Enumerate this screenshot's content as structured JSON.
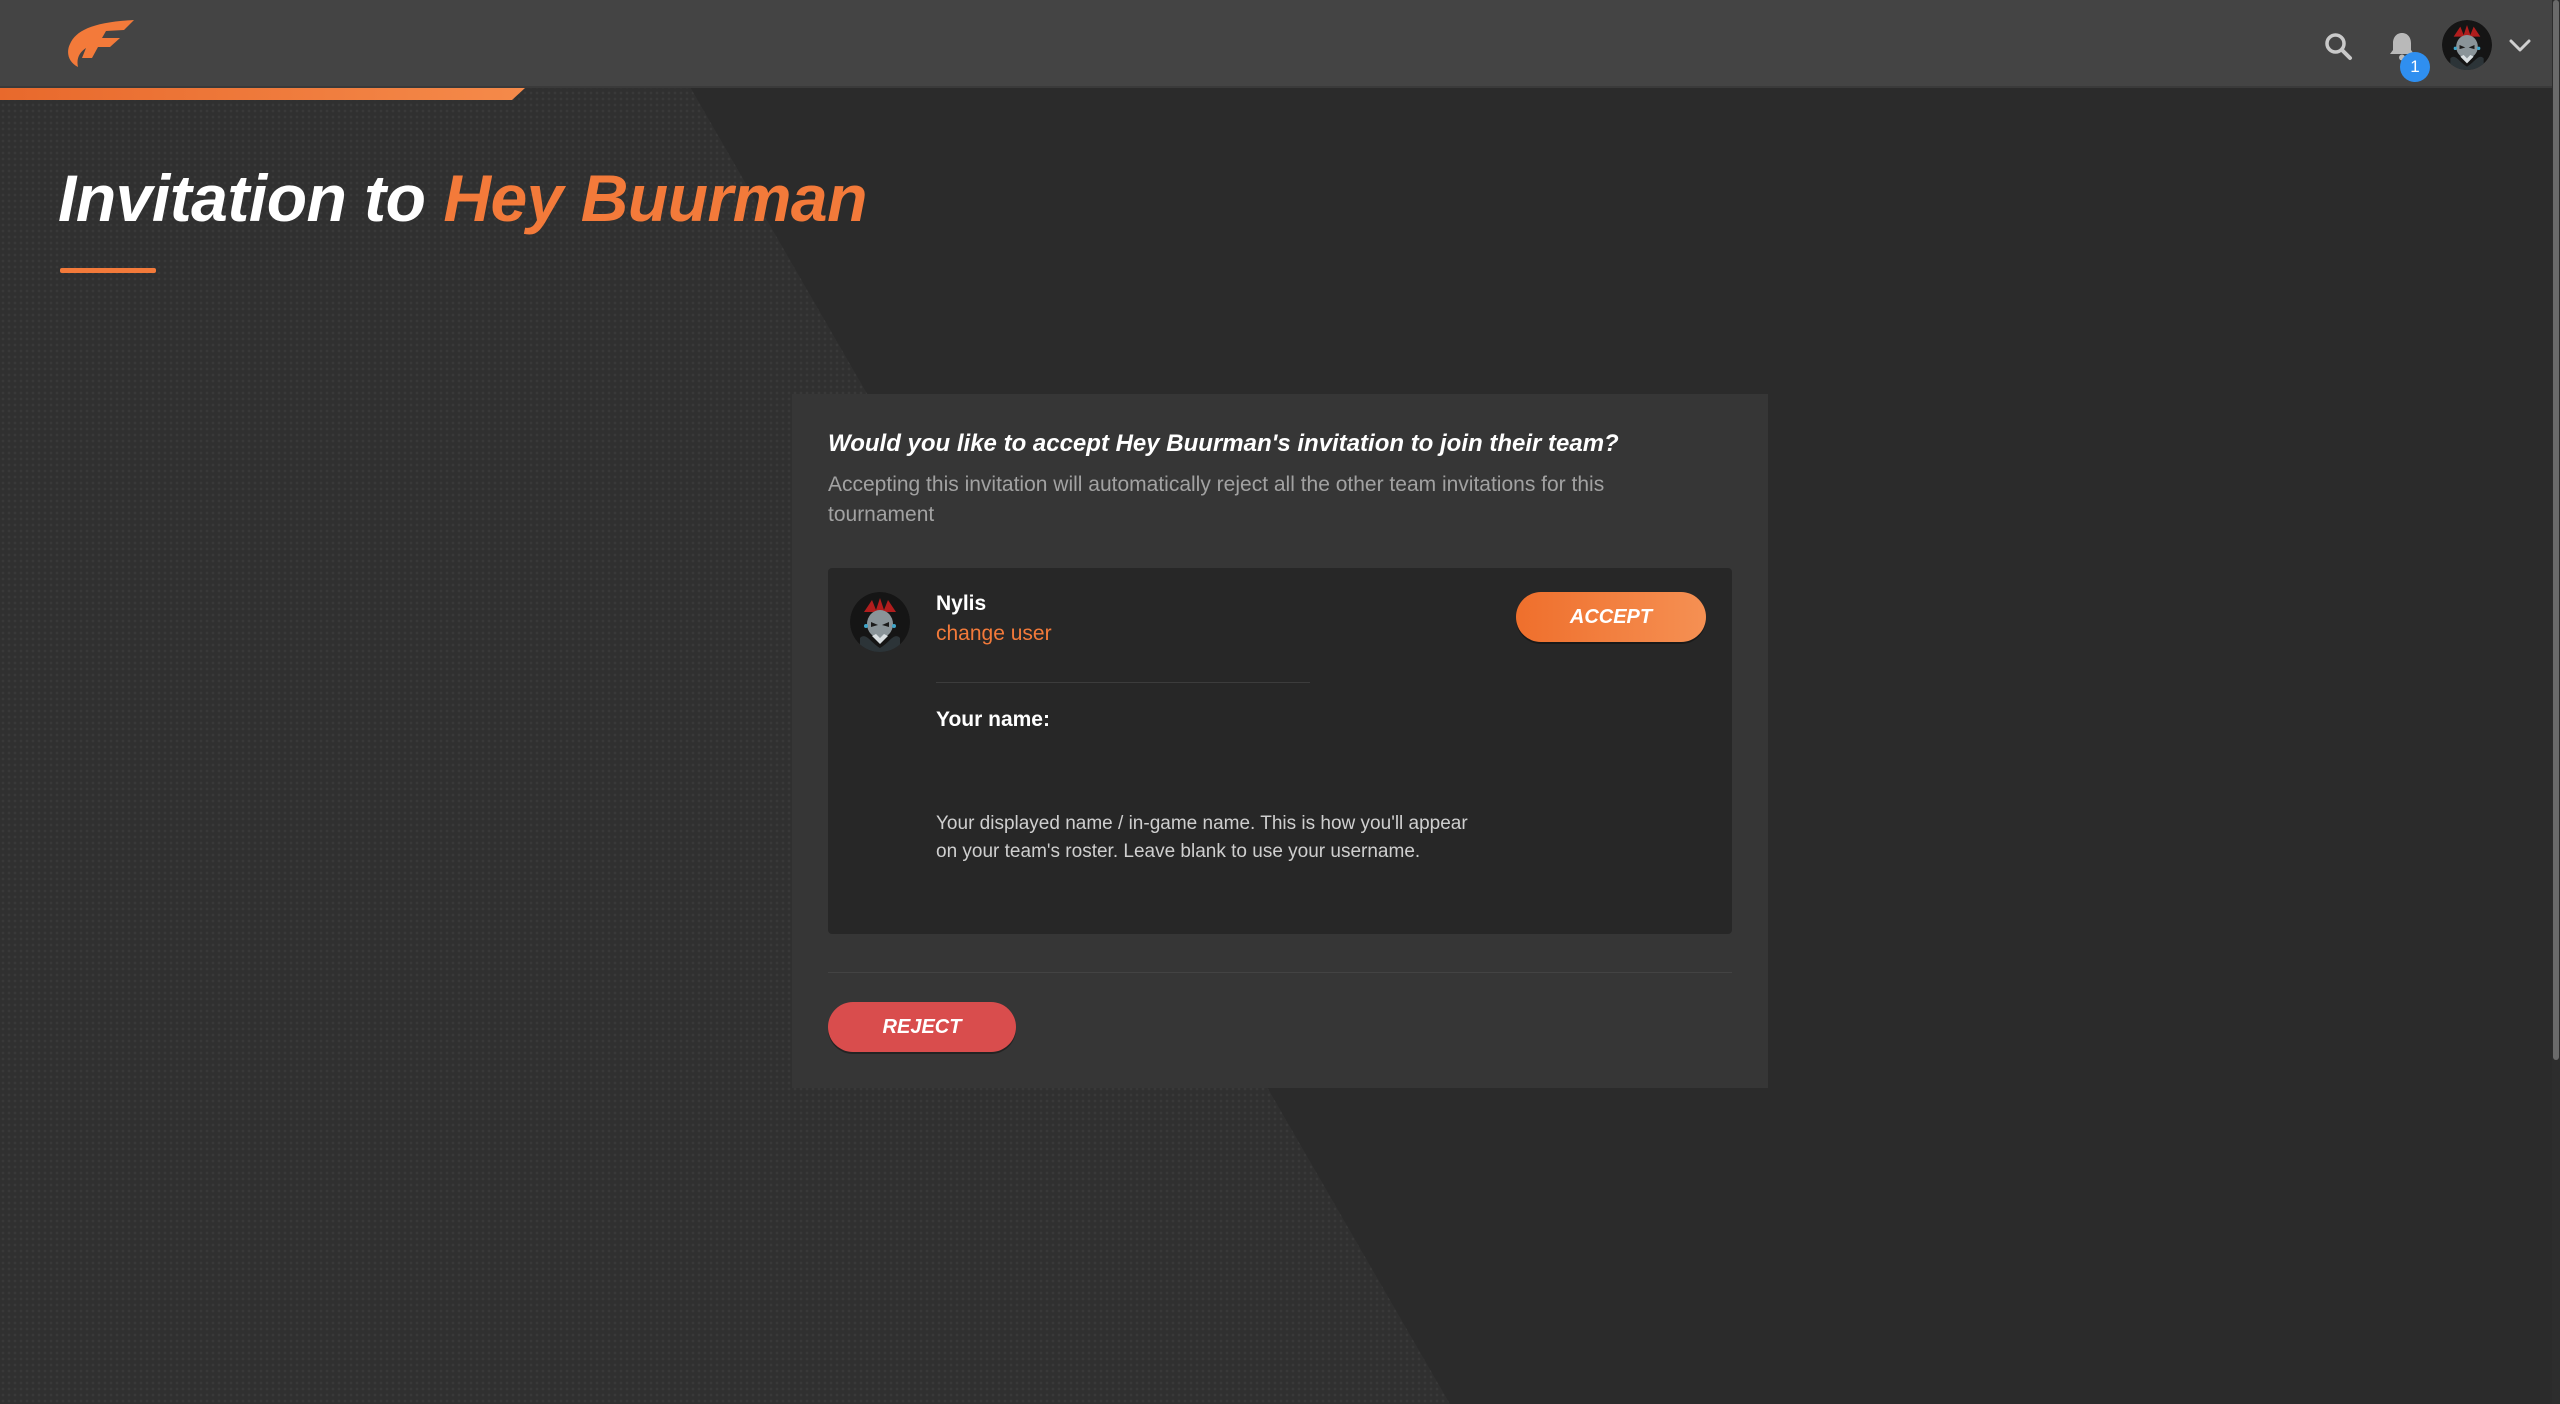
{
  "header": {
    "logo_icon": "brand-logo-icon",
    "search_icon": "search-icon",
    "bell_icon": "bell-icon",
    "notification_count": "1",
    "chevron_icon": "chevron-down-icon"
  },
  "page": {
    "title_prefix": "Invitation to",
    "title_team": "Hey Buurman"
  },
  "invitation": {
    "question": "Would you like to accept Hey Buurman's invitation to join their team?",
    "subtitle": "Accepting this invitation will automatically reject all the other team invitations for this tournament",
    "user": {
      "name": "Nylis",
      "change_user_label": "change user"
    },
    "accept_label": "ACCEPT",
    "name_field": {
      "label": "Your name:",
      "value": "",
      "placeholder": "",
      "help": "Your displayed name / in-game name. This is how you'll appear on your team's roster. Leave blank to use your username."
    },
    "reject_label": "REJECT"
  },
  "colors": {
    "accent": "#f37a3a",
    "background": "#2b2b2b",
    "card": "#363636",
    "panel": "#272727",
    "reject": "#d94d4d",
    "badge": "#2f8ff0"
  }
}
